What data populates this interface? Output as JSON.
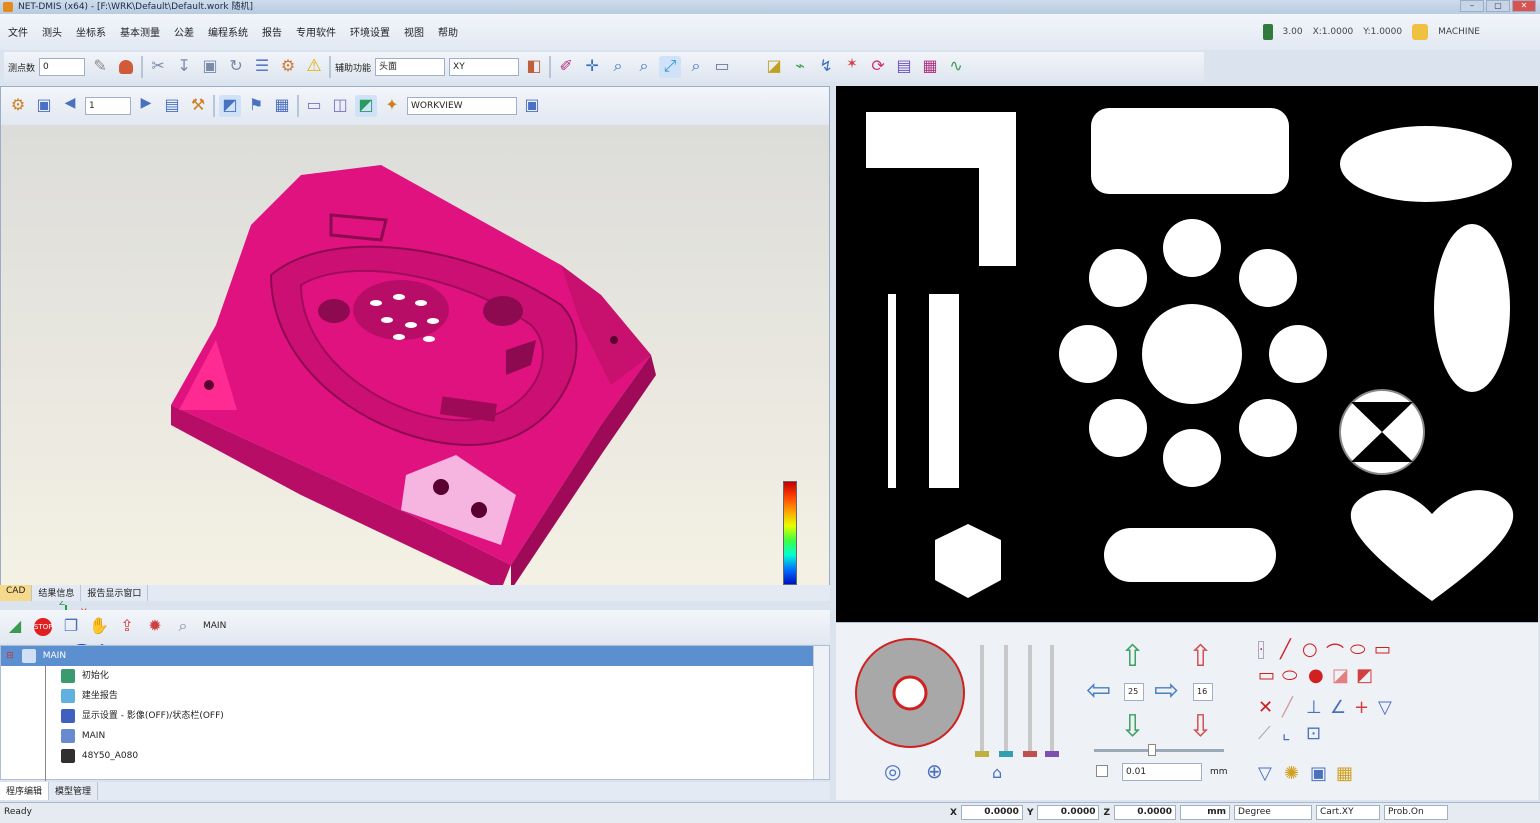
{
  "titlebar": {
    "text": "NET-DMIS (x64) - [F:\\WRK\\Default\\Default.work 随机]"
  },
  "menu": [
    "文件",
    "测头",
    "坐标系",
    "基本测量",
    "公差",
    "编程系统",
    "报告",
    "专用软件",
    "环境设置",
    "视图",
    "帮助"
  ],
  "status_top": {
    "scale": "3.00",
    "ratio1": "X:1.0000",
    "ratio2": "Y:1.0000",
    "machine": "MACHINE"
  },
  "toolbar2": {
    "label": "测点数",
    "value": "0",
    "func_label": "辅助功能",
    "func_value": "头面",
    "plane": "XY"
  },
  "cad_toolbar": {
    "page": "1",
    "view": "WORKVIEW"
  },
  "bottom_tabs": [
    "CAD",
    "结果信息",
    "报告显示窗口"
  ],
  "prog_toolbar": {
    "prog": "MAIN"
  },
  "tree": {
    "root": "MAIN",
    "items": [
      "初始化",
      "建坐报告",
      "显示设置 - 影像(OFF)/状态栏(OFF)",
      "MAIN",
      "48Y50_A080"
    ]
  },
  "prog_tabs": [
    "程序编辑",
    "模型管理"
  ],
  "controls": {
    "step1": "25",
    "step2": "16",
    "precision": "0.01",
    "unit": "mm"
  },
  "statusbar": {
    "ready": "Ready",
    "x": "0.0000",
    "y": "0.0000",
    "z": "0.0000",
    "unit": "mm",
    "angle": "Degree",
    "coordsys": "Cart.XY",
    "probe": "Prob.On"
  },
  "colors": {
    "part": "#e0127f",
    "accent": "#5b8fd0"
  }
}
